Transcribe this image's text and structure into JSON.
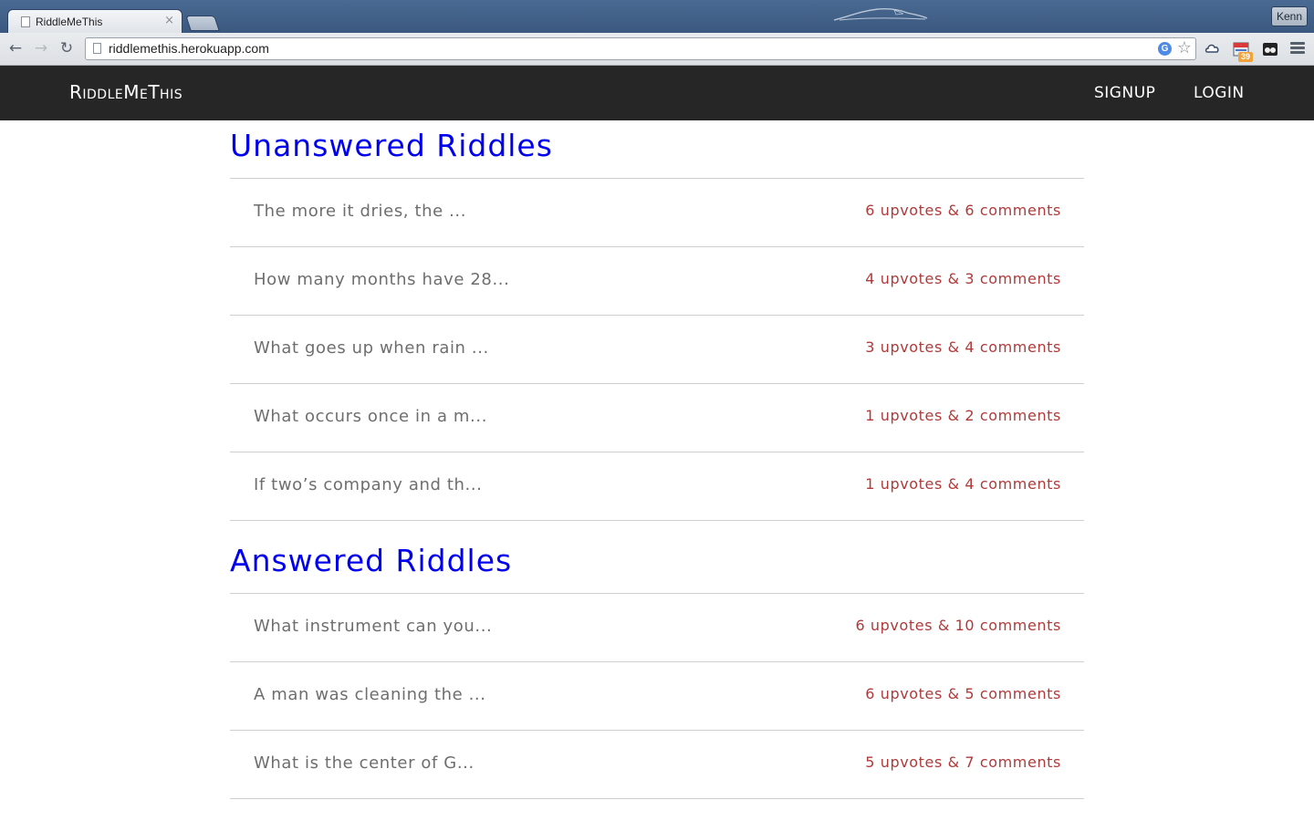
{
  "browser": {
    "tab_title": "RiddleMeThis",
    "tab_close": "×",
    "url": "riddlemethis.herokuapp.com",
    "user": "Kenn",
    "extension_badge": "39"
  },
  "navbar": {
    "brand": "RiddleMeThis",
    "signup": "SIGNUP",
    "login": "LOGIN"
  },
  "sections": [
    {
      "title": "Unanswered Riddles",
      "riddles": [
        {
          "text": "The more it dries, the ...",
          "stats": "6 upvotes & 6 comments"
        },
        {
          "text": "How many months have 28...",
          "stats": "4 upvotes & 3 comments"
        },
        {
          "text": "What goes up when rain ...",
          "stats": "3 upvotes & 4 comments"
        },
        {
          "text": "What occurs once in a m...",
          "stats": "1 upvotes & 2 comments"
        },
        {
          "text": "If two’s company and th...",
          "stats": "1 upvotes & 4 comments"
        }
      ]
    },
    {
      "title": "Answered Riddles",
      "riddles": [
        {
          "text": "What instrument can you...",
          "stats": "6 upvotes & 10 comments"
        },
        {
          "text": "A man was cleaning the ...",
          "stats": "6 upvotes & 5 comments"
        },
        {
          "text": "What is the center of G...",
          "stats": "5 upvotes & 7 comments"
        }
      ]
    }
  ]
}
